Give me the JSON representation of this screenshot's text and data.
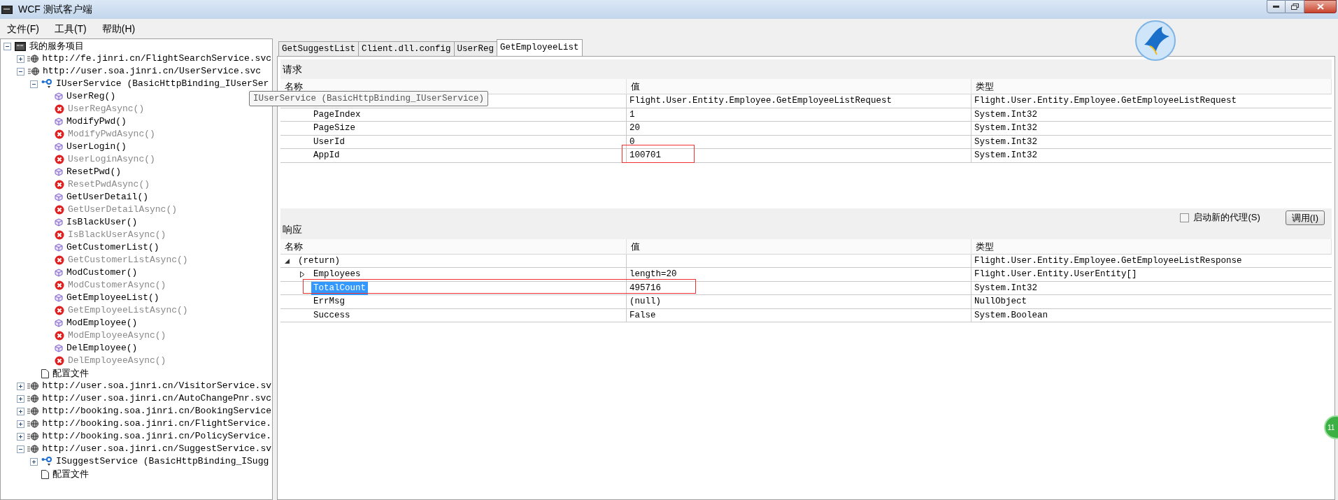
{
  "window": {
    "title": "WCF 测试客户端"
  },
  "menu": [
    "文件(F)",
    "工具(T)",
    "帮助(H)"
  ],
  "tree": [
    {
      "kind": "root",
      "label": "我的服务项目",
      "expanded": true,
      "children": [
        {
          "kind": "endpoint",
          "label": "http://fe.jinri.cn/FlightSearchService.svc",
          "expanded": false
        },
        {
          "kind": "endpoint",
          "label": "http://user.soa.jinri.cn/UserService.svc",
          "expanded": true,
          "children": [
            {
              "kind": "contract",
              "label": "IUserService (BasicHttpBinding_IUserSer",
              "expanded": true,
              "children": [
                {
                  "kind": "method",
                  "label": "UserReg()",
                  "disabled": false
                },
                {
                  "kind": "method",
                  "label": "UserRegAsync()",
                  "disabled": true
                },
                {
                  "kind": "method",
                  "label": "ModifyPwd()",
                  "disabled": false
                },
                {
                  "kind": "method",
                  "label": "ModifyPwdAsync()",
                  "disabled": true
                },
                {
                  "kind": "method",
                  "label": "UserLogin()",
                  "disabled": false
                },
                {
                  "kind": "method",
                  "label": "UserLoginAsync()",
                  "disabled": true
                },
                {
                  "kind": "method",
                  "label": "ResetPwd()",
                  "disabled": false
                },
                {
                  "kind": "method",
                  "label": "ResetPwdAsync()",
                  "disabled": true
                },
                {
                  "kind": "method",
                  "label": "GetUserDetail()",
                  "disabled": false
                },
                {
                  "kind": "method",
                  "label": "GetUserDetailAsync()",
                  "disabled": true
                },
                {
                  "kind": "method",
                  "label": "IsBlackUser()",
                  "disabled": false
                },
                {
                  "kind": "method",
                  "label": "IsBlackUserAsync()",
                  "disabled": true
                },
                {
                  "kind": "method",
                  "label": "GetCustomerList()",
                  "disabled": false
                },
                {
                  "kind": "method",
                  "label": "GetCustomerListAsync()",
                  "disabled": true
                },
                {
                  "kind": "method",
                  "label": "ModCustomer()",
                  "disabled": false
                },
                {
                  "kind": "method",
                  "label": "ModCustomerAsync()",
                  "disabled": true
                },
                {
                  "kind": "method",
                  "label": "GetEmployeeList()",
                  "disabled": false
                },
                {
                  "kind": "method",
                  "label": "GetEmployeeListAsync()",
                  "disabled": true
                },
                {
                  "kind": "method",
                  "label": "ModEmployee()",
                  "disabled": false
                },
                {
                  "kind": "method",
                  "label": "ModEmployeeAsync()",
                  "disabled": true
                },
                {
                  "kind": "method",
                  "label": "DelEmployee()",
                  "disabled": false
                },
                {
                  "kind": "method",
                  "label": "DelEmployeeAsync()",
                  "disabled": true
                }
              ]
            },
            {
              "kind": "config",
              "label": "配置文件"
            }
          ]
        },
        {
          "kind": "endpoint",
          "label": "http://user.soa.jinri.cn/VisitorService.sv",
          "expanded": false
        },
        {
          "kind": "endpoint",
          "label": "http://user.soa.jinri.cn/AutoChangePnr.svc",
          "expanded": false
        },
        {
          "kind": "endpoint",
          "label": "http://booking.soa.jinri.cn/BookingService",
          "expanded": false
        },
        {
          "kind": "endpoint",
          "label": "http://booking.soa.jinri.cn/FlightService.",
          "expanded": false
        },
        {
          "kind": "endpoint",
          "label": "http://booking.soa.jinri.cn/PolicyService.",
          "expanded": false
        },
        {
          "kind": "endpoint",
          "label": "http://user.soa.jinri.cn/SuggestService.sv",
          "expanded": true,
          "children": [
            {
              "kind": "contract",
              "label": "ISuggestService (BasicHttpBinding_ISugg",
              "expanded": false
            },
            {
              "kind": "config",
              "label": "配置文件"
            }
          ]
        }
      ]
    }
  ],
  "tooltip": "IUserService (BasicHttpBinding_IUserService)",
  "tabs": [
    {
      "label": "GetSuggestList",
      "selected": false
    },
    {
      "label": "Client.dll.config",
      "selected": false
    },
    {
      "label": "UserReg",
      "selected": false
    },
    {
      "label": "GetEmployeeList",
      "selected": true
    }
  ],
  "request": {
    "title": "请求",
    "columns": [
      "名称",
      "值",
      "类型"
    ],
    "rows": [
      {
        "value": "Flight.User.Entity.Employee.GetEmployeeListRequest",
        "type": "Flight.User.Entity.Employee.GetEmployeeListRequest",
        "children": [
          {
            "name": "PageIndex",
            "value": "1",
            "type": "System.Int32"
          },
          {
            "name": "PageSize",
            "value": "20",
            "type": "System.Int32"
          },
          {
            "name": "UserId",
            "value": "0",
            "type": "System.Int32"
          },
          {
            "name": "AppId",
            "value": "100701",
            "type": "System.Int32",
            "value_circled": true
          }
        ]
      }
    ]
  },
  "response": {
    "title": "响应",
    "new_proxy": {
      "label": "启动新的代理(S)",
      "checked": false
    },
    "invoke_button": "调用(I)",
    "columns": [
      "名称",
      "值",
      "类型"
    ],
    "rows": [
      {
        "name": "(return)",
        "expanded": true,
        "selected": false,
        "type": "Flight.User.Entity.Employee.GetEmployeeListResponse",
        "children": [
          {
            "name": "Employees",
            "expanded": false,
            "selected": false,
            "value": "length=20",
            "type": "Flight.User.Entity.UserEntity[]"
          },
          {
            "name": "TotalCount",
            "selected": true,
            "value": "495716",
            "type": "System.Int32",
            "row_circled": true
          },
          {
            "name": "ErrMsg",
            "selected": false,
            "value": "(null)",
            "type": "NullObject"
          },
          {
            "name": "Success",
            "selected": false,
            "value": "False",
            "type": "System.Boolean"
          }
        ]
      }
    ]
  },
  "floating_badge": "11"
}
